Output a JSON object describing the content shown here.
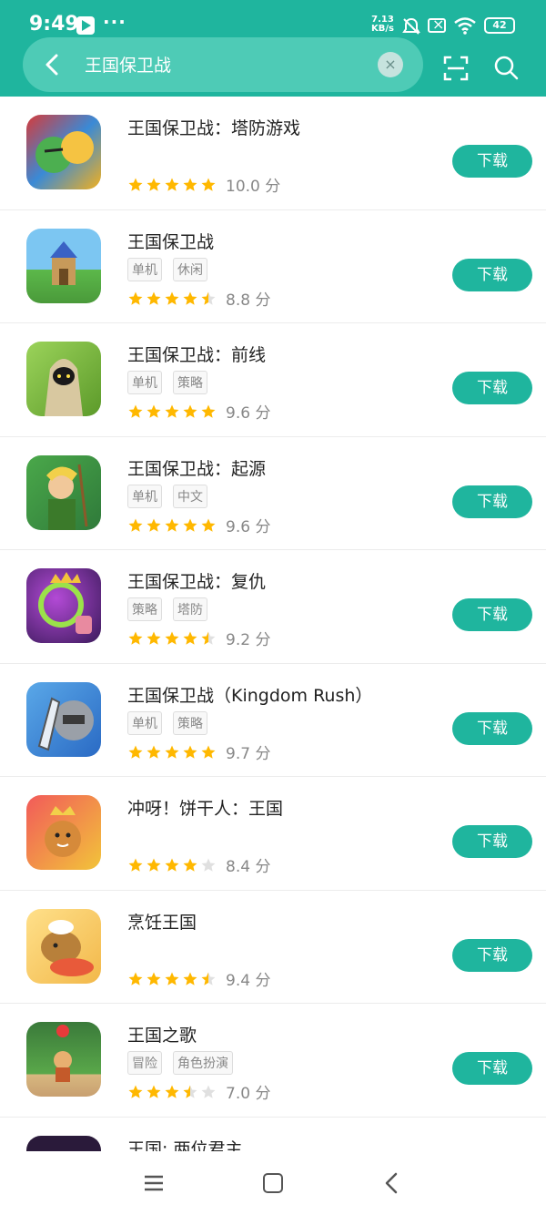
{
  "status_bar": {
    "time": "9:49",
    "more": "···",
    "net_speed_value": "7.13",
    "net_speed_unit": "KB/s",
    "battery": "42"
  },
  "search": {
    "query": "王国保卫战",
    "clear_symbol": "×"
  },
  "icons": {
    "back": "back-arrow-icon",
    "clear": "close-icon",
    "scan": "scan-icon",
    "search": "search-icon"
  },
  "colors": {
    "accent": "#1fb59e",
    "star_full": "#ffb800",
    "star_empty": "#e0e0e0"
  },
  "results": [
    {
      "title": "王国保卫战：塔防游戏",
      "tags": [],
      "stars": 5,
      "score": "10.0 分",
      "action": "下载"
    },
    {
      "title": "王国保卫战",
      "tags": [
        "单机",
        "休闲"
      ],
      "stars": 4.5,
      "score": "8.8 分",
      "action": "下载"
    },
    {
      "title": "王国保卫战：前线",
      "tags": [
        "单机",
        "策略"
      ],
      "stars": 5,
      "score": "9.6 分",
      "action": "下载"
    },
    {
      "title": "王国保卫战：起源",
      "tags": [
        "单机",
        "中文"
      ],
      "stars": 5,
      "score": "9.6 分",
      "action": "下载"
    },
    {
      "title": "王国保卫战：复仇",
      "tags": [
        "策略",
        "塔防"
      ],
      "stars": 4.5,
      "score": "9.2 分",
      "action": "下载"
    },
    {
      "title": "王国保卫战（Kingdom Rush）",
      "tags": [
        "单机",
        "策略"
      ],
      "stars": 5,
      "score": "9.7 分",
      "action": "下载"
    },
    {
      "title": "冲呀！饼干人：王国",
      "tags": [],
      "stars": 4,
      "score": "8.4 分",
      "action": "下载"
    },
    {
      "title": "烹饪王国",
      "tags": [],
      "stars": 4.5,
      "score": "9.4 分",
      "action": "下载"
    },
    {
      "title": "王国之歌",
      "tags": [
        "冒险",
        "角色扮演"
      ],
      "stars": 3.5,
      "score": "7.0 分",
      "action": "下载"
    },
    {
      "title": "王国: 两位君主",
      "tags": [],
      "stars": null,
      "score": null,
      "action": null
    }
  ],
  "navbar": {
    "menu": "menu-icon",
    "home": "home-icon",
    "back": "back-icon"
  }
}
